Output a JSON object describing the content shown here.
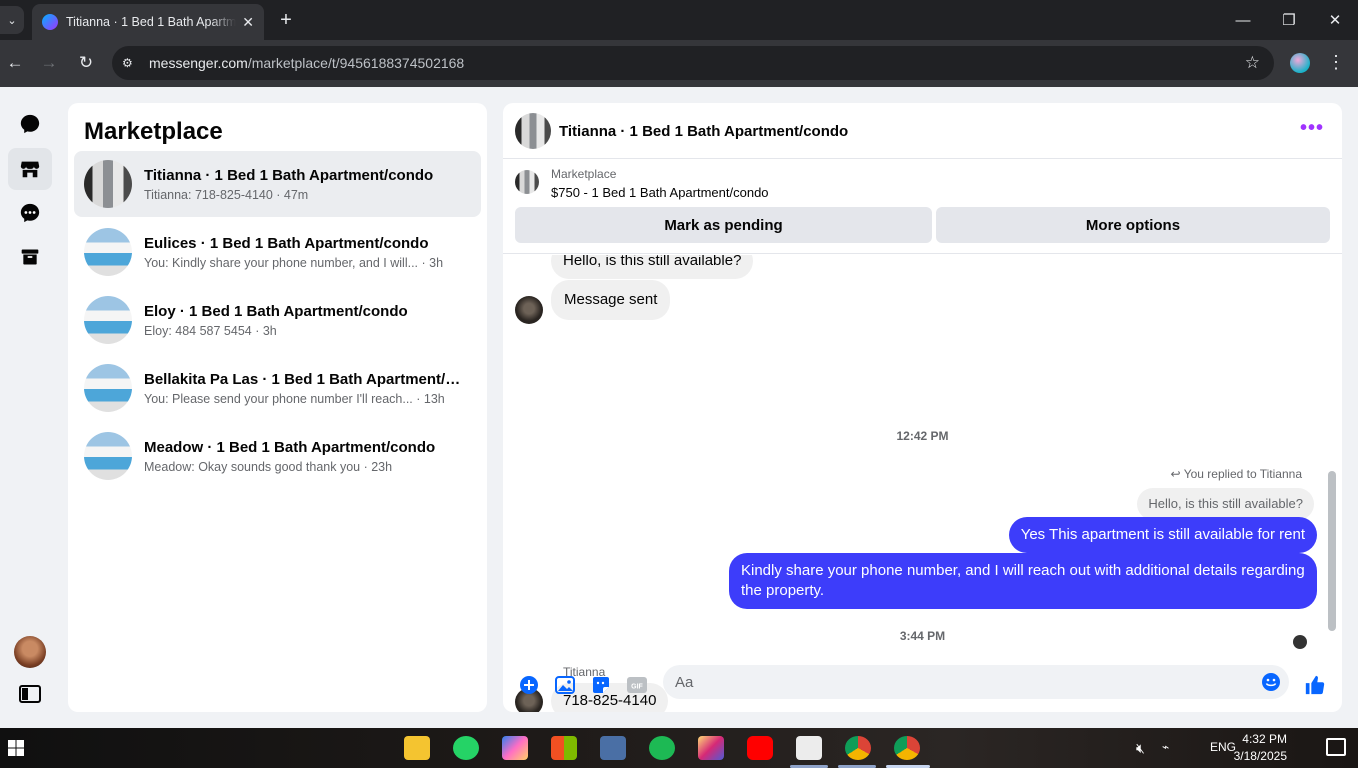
{
  "browser": {
    "tab_title": "Titianna · 1 Bed 1 Bath Apartment/condo",
    "url_host": "messenger.com",
    "url_path": "/marketplace/t/9456188374502168"
  },
  "sidebar": {
    "title": "Marketplace",
    "conversations": [
      {
        "name": "Titianna · 1 Bed 1 Bath Apartment/condo",
        "preview": "Titianna: 718-825-4140 · 47m"
      },
      {
        "name": "Eulices · 1 Bed 1 Bath Apartment/condo",
        "preview": "You: Kindly share your phone number, and I will... · 3h"
      },
      {
        "name": "Eloy · 1 Bed 1 Bath Apartment/condo",
        "preview": "Eloy: 484 587 5454 · 3h"
      },
      {
        "name": "Bellakita Pa Las · 1 Bed 1 Bath Apartment/c...",
        "preview": "You: Please send your phone number I'll reach... · 13h"
      },
      {
        "name": "Meadow · 1 Bed 1 Bath Apartment/condo",
        "preview": "Meadow: Okay sounds good thank you · 23h"
      }
    ]
  },
  "chat": {
    "title": "Titianna · 1 Bed 1 Bath Apartment/condo",
    "marketplace_label": "Marketplace",
    "listing": "$750 - 1 Bed 1 Bath Apartment/condo",
    "mark_pending": "Mark as pending",
    "more_options": "More options",
    "messages": {
      "m1": "Hello, is this still available?",
      "m2": "Message sent",
      "ts1": "12:42 PM",
      "reply_note": "You replied to Titianna",
      "quote": "Hello, is this still available?",
      "m3": "Yes This apartment is still available for rent",
      "m4": "Kindly share your phone number, and I will reach out with additional details regarding the property.",
      "ts2": "3:44 PM",
      "sender": "Titianna",
      "m5": "718-825-4140"
    },
    "composer_placeholder": "Aa"
  },
  "taskbar": {
    "time": "4:32 PM",
    "date": "3/18/2025",
    "lang": "ENG"
  },
  "colors": {
    "accent": "#3d3dfa",
    "brand": "#0866ff",
    "menu_dots": "#a033ff"
  }
}
